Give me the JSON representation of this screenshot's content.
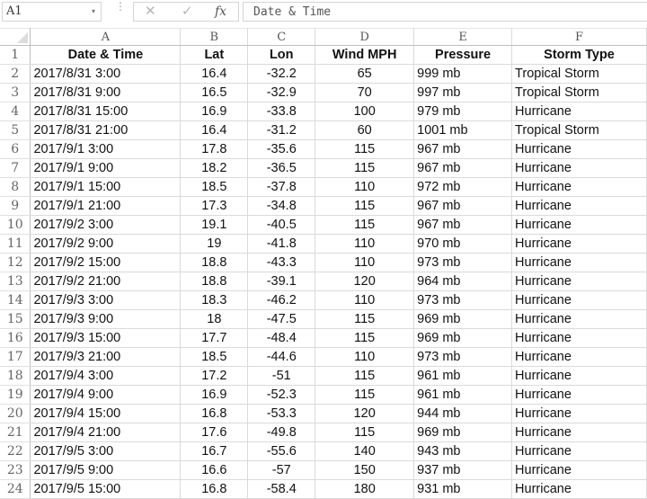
{
  "toolbar": {
    "name_box": "A1",
    "name_box_dropdown_icon": "▾",
    "grip_icon": "⋮",
    "cancel_icon": "✕",
    "enter_icon": "✓",
    "fx_label": "fx",
    "formula_value": "Date & Time"
  },
  "columns": [
    "A",
    "B",
    "C",
    "D",
    "E",
    "F"
  ],
  "header_row": {
    "row_number": "1",
    "cells": [
      "Date & Time",
      "Lat",
      "Lon",
      "Wind MPH",
      "Pressure",
      "Storm Type"
    ]
  },
  "rows": [
    {
      "n": "2",
      "date": "2017/8/31 3:00",
      "lat": "16.4",
      "lon": "-32.2",
      "wind": "65",
      "pressure": "999 mb",
      "type": "Tropical Storm"
    },
    {
      "n": "3",
      "date": "2017/8/31 9:00",
      "lat": "16.5",
      "lon": "-32.9",
      "wind": "70",
      "pressure": "997 mb",
      "type": "Tropical Storm"
    },
    {
      "n": "4",
      "date": "2017/8/31 15:00",
      "lat": "16.9",
      "lon": "-33.8",
      "wind": "100",
      "pressure": "979 mb",
      "type": "Hurricane"
    },
    {
      "n": "5",
      "date": "2017/8/31 21:00",
      "lat": "16.4",
      "lon": "-31.2",
      "wind": "60",
      "pressure": "1001 mb",
      "type": "Tropical Storm"
    },
    {
      "n": "6",
      "date": "2017/9/1 3:00",
      "lat": "17.8",
      "lon": "-35.6",
      "wind": "115",
      "pressure": "967 mb",
      "type": "Hurricane"
    },
    {
      "n": "7",
      "date": "2017/9/1 9:00",
      "lat": "18.2",
      "lon": "-36.5",
      "wind": "115",
      "pressure": "967 mb",
      "type": "Hurricane"
    },
    {
      "n": "8",
      "date": "2017/9/1 15:00",
      "lat": "18.5",
      "lon": "-37.8",
      "wind": "110",
      "pressure": "972 mb",
      "type": "Hurricane"
    },
    {
      "n": "9",
      "date": "2017/9/1 21:00",
      "lat": "17.3",
      "lon": "-34.8",
      "wind": "115",
      "pressure": "967 mb",
      "type": "Hurricane"
    },
    {
      "n": "10",
      "date": "2017/9/2 3:00",
      "lat": "19.1",
      "lon": "-40.5",
      "wind": "115",
      "pressure": "967 mb",
      "type": "Hurricane"
    },
    {
      "n": "11",
      "date": "2017/9/2 9:00",
      "lat": "19",
      "lon": "-41.8",
      "wind": "110",
      "pressure": "970 mb",
      "type": "Hurricane"
    },
    {
      "n": "12",
      "date": "2017/9/2 15:00",
      "lat": "18.8",
      "lon": "-43.3",
      "wind": "110",
      "pressure": "973 mb",
      "type": "Hurricane"
    },
    {
      "n": "13",
      "date": "2017/9/2 21:00",
      "lat": "18.8",
      "lon": "-39.1",
      "wind": "120",
      "pressure": "964 mb",
      "type": "Hurricane"
    },
    {
      "n": "14",
      "date": "2017/9/3 3:00",
      "lat": "18.3",
      "lon": "-46.2",
      "wind": "110",
      "pressure": "973 mb",
      "type": "Hurricane"
    },
    {
      "n": "15",
      "date": "2017/9/3 9:00",
      "lat": "18",
      "lon": "-47.5",
      "wind": "115",
      "pressure": "969 mb",
      "type": "Hurricane"
    },
    {
      "n": "16",
      "date": "2017/9/3 15:00",
      "lat": "17.7",
      "lon": "-48.4",
      "wind": "115",
      "pressure": "969 mb",
      "type": "Hurricane"
    },
    {
      "n": "17",
      "date": "2017/9/3 21:00",
      "lat": "18.5",
      "lon": "-44.6",
      "wind": "110",
      "pressure": "973 mb",
      "type": "Hurricane"
    },
    {
      "n": "18",
      "date": "2017/9/4 3:00",
      "lat": "17.2",
      "lon": "-51",
      "wind": "115",
      "pressure": "961 mb",
      "type": "Hurricane"
    },
    {
      "n": "19",
      "date": "2017/9/4 9:00",
      "lat": "16.9",
      "lon": "-52.3",
      "wind": "115",
      "pressure": "961 mb",
      "type": "Hurricane"
    },
    {
      "n": "20",
      "date": "2017/9/4 15:00",
      "lat": "16.8",
      "lon": "-53.3",
      "wind": "120",
      "pressure": "944 mb",
      "type": "Hurricane"
    },
    {
      "n": "21",
      "date": "2017/9/4 21:00",
      "lat": "17.6",
      "lon": "-49.8",
      "wind": "115",
      "pressure": "969 mb",
      "type": "Hurricane"
    },
    {
      "n": "22",
      "date": "2017/9/5 3:00",
      "lat": "16.7",
      "lon": "-55.6",
      "wind": "140",
      "pressure": "943 mb",
      "type": "Hurricane"
    },
    {
      "n": "23",
      "date": "2017/9/5 9:00",
      "lat": "16.6",
      "lon": "-57",
      "wind": "150",
      "pressure": "937 mb",
      "type": "Hurricane"
    },
    {
      "n": "24",
      "date": "2017/9/5 15:00",
      "lat": "16.8",
      "lon": "-58.4",
      "wind": "180",
      "pressure": "931 mb",
      "type": "Hurricane"
    }
  ]
}
